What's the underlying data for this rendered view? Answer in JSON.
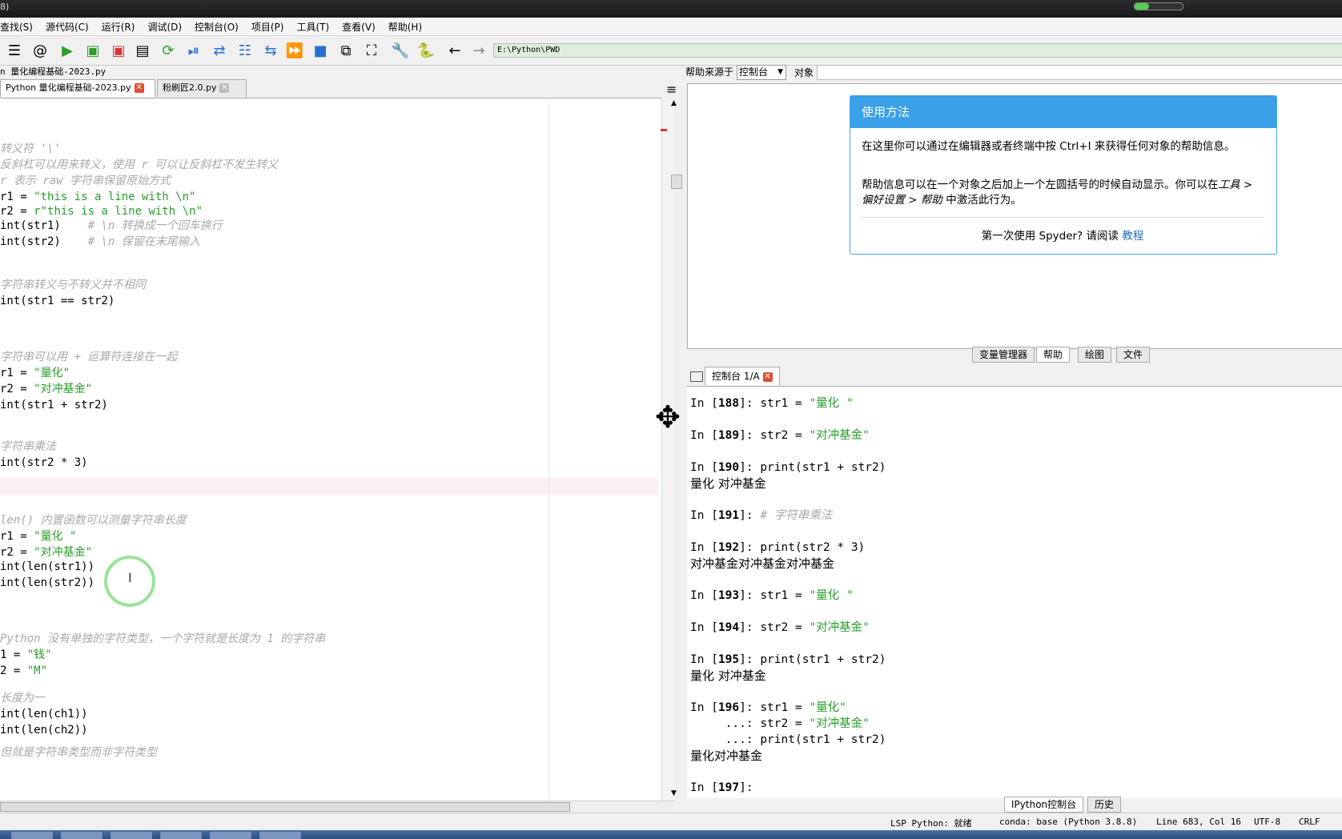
{
  "window": {
    "title_fragment": "8)"
  },
  "menu": [
    "查找(S)",
    "源代码(C)",
    "运行(R)",
    "调试(D)",
    "控制台(O)",
    "项目(P)",
    "工具(T)",
    "查看(V)",
    "帮助(H)"
  ],
  "toolbar": {
    "path": "E:\\Python\\PWD"
  },
  "editor": {
    "file_path": "n 量化编程基础-2023.py",
    "tabs": [
      {
        "label": "Python 量化编程基础-2023.py",
        "active": true
      },
      {
        "label": "粉刷匠2.0.py",
        "active": false
      }
    ],
    "lines": [
      {
        "text": "转义符 '\\'",
        "kind": "comment"
      },
      {
        "text": "反斜杠可以用来转义，使用 r 可以让反斜杠不发生转义",
        "kind": "comment"
      },
      {
        "text": "r 表示 raw 字符串保留原始方式",
        "kind": "comment"
      },
      {
        "pre": "r1 = ",
        "str": "\"this is a line with \\n\"",
        "post": ""
      },
      {
        "pre": "r2 = ",
        "str": "r\"this is a line with \\n\"",
        "post": ""
      },
      {
        "pre": "int(str1)    ",
        "cm": "# \\n 转换成一个回车换行"
      },
      {
        "pre": "int(str2)    ",
        "cm": "# \\n 保留在末尾输入"
      },
      {
        "text": "字符串转义与不转义并不相同",
        "kind": "comment"
      },
      {
        "pre": "int(str1 == str2)"
      },
      {
        "text": "字符串可以用 + 运算符连接在一起",
        "kind": "comment"
      },
      {
        "pre": "r1 = ",
        "str": "\"量化\""
      },
      {
        "pre": "r2 = ",
        "str": "\"对冲基金\""
      },
      {
        "pre": "int(str1 + str2)"
      },
      {
        "text": "字符串乘法",
        "kind": "comment"
      },
      {
        "pre": "int(str2 * 3)"
      },
      {
        "text": "len() 内置函数可以测量字符串长度",
        "kind": "comment"
      },
      {
        "pre": "r1 = ",
        "str": "\"量化 \""
      },
      {
        "pre": "r2 = ",
        "str": "\"对冲基金\""
      },
      {
        "pre": "int(len(str1))"
      },
      {
        "pre": "int(len(str2))"
      },
      {
        "text": "Python 没有单独的字符类型，一个字符就是长度为 1 的字符串",
        "kind": "comment"
      },
      {
        "pre": "1 = ",
        "str": "\"钱\""
      },
      {
        "pre": "2 = ",
        "str": "\"M\""
      },
      {
        "text": "长度为一",
        "kind": "comment"
      },
      {
        "pre": "int(len(ch1))"
      },
      {
        "pre": "int(len(ch2))"
      },
      {
        "text": "但就是字符串类型而非字符类型",
        "kind": "comment"
      }
    ]
  },
  "help": {
    "source_label": "帮助来源于",
    "source_value": "控制台",
    "object_label": "对象",
    "card_title": "使用方法",
    "para1": "在这里你可以通过在编辑器或者终端中按 Ctrl+I 来获得任何对象的帮助信息。",
    "para2a": "帮助信息可以在一个对象之后加上一个左圆括号的时候自动显示。你可以在",
    "para2b": "工具 > 偏好设置 > 帮助",
    "para2c": " 中激活此行为。",
    "footer": "第一次使用 Spyder? 请阅读 ",
    "footer_link": "教程",
    "tabs": [
      "变量管理器",
      "帮助",
      "绘图",
      "文件"
    ]
  },
  "console": {
    "tab_label": "控制台 1/A",
    "lines": [
      {
        "n": "188",
        "code": "str1 = ",
        "str": "\"量化 \""
      },
      {
        "n": "189",
        "code": "str2 = ",
        "str": "\"对冲基金\""
      },
      {
        "n": "190",
        "code": "print(str1 + str2)"
      },
      {
        "out": "量化 对冲基金"
      },
      {
        "n": "191",
        "cm": "# 字符串乘法"
      },
      {
        "n": "192",
        "code": "print(str2 * 3)"
      },
      {
        "out": "对冲基金对冲基金对冲基金"
      },
      {
        "n": "193",
        "code": "str1 = ",
        "str": "\"量化 \""
      },
      {
        "n": "194",
        "code": "str2 = ",
        "str": "\"对冲基金\""
      },
      {
        "n": "195",
        "code": "print(str1 + str2)"
      },
      {
        "out": "量化 对冲基金"
      },
      {
        "n": "196",
        "code": "str1 = ",
        "str": "\"量化\""
      },
      {
        "cont": "str2 = ",
        "str": "\"对冲基金\""
      },
      {
        "cont": "print(str1 + str2)"
      },
      {
        "out": "量化对冲基金"
      },
      {
        "n": "197",
        "code": ""
      }
    ],
    "bottom_tabs": [
      "IPython控制台",
      "历史"
    ]
  },
  "status": {
    "lsp": "LSP Python: 就绪",
    "conda": "conda: base (Python 3.8.8)",
    "position": "Line 683, Col 16",
    "encoding": "UTF-8",
    "eol": "CRLF"
  }
}
